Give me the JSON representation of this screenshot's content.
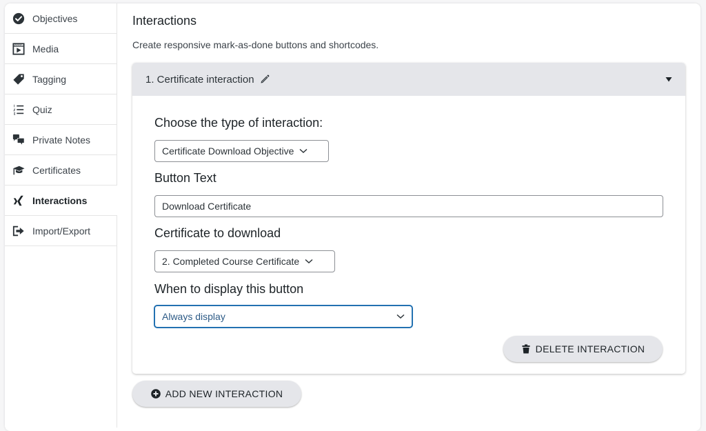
{
  "sidebar": {
    "items": [
      {
        "label": "Objectives",
        "icon": "check-circle-icon"
      },
      {
        "label": "Media",
        "icon": "video-icon"
      },
      {
        "label": "Tagging",
        "icon": "tag-icon"
      },
      {
        "label": "Quiz",
        "icon": "numbered-list-icon"
      },
      {
        "label": "Private Notes",
        "icon": "comments-icon"
      },
      {
        "label": "Certificates",
        "icon": "graduation-cap-icon"
      },
      {
        "label": "Interactions",
        "icon": "interactions-icon",
        "active": true
      },
      {
        "label": "Import/Export",
        "icon": "export-icon"
      }
    ]
  },
  "main": {
    "title": "Interactions",
    "description": "Create responsive mark-as-done buttons and shortcodes."
  },
  "interaction": {
    "header_title": "1. Certificate interaction",
    "type_label": "Choose the type of interaction:",
    "type_value": "Certificate Download Objective",
    "button_text_label": "Button Text",
    "button_text_value": "Download Certificate",
    "certificate_label": "Certificate to download",
    "certificate_value": "2. Completed Course Certificate",
    "display_label": "When to display this button",
    "display_value": "Always display",
    "delete_label": "DELETE INTERACTION"
  },
  "add_button_label": "ADD NEW INTERACTION",
  "colors": {
    "focus": "#2271b1",
    "header_bg": "#e5e6ea",
    "button_bg": "#e5e6ea"
  }
}
